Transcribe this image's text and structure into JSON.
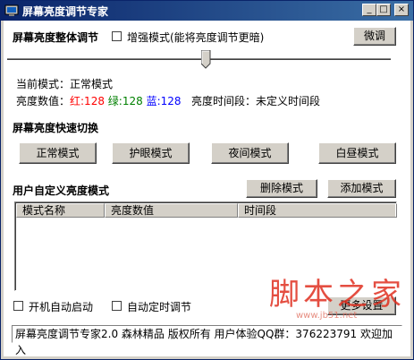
{
  "window": {
    "title": "屏幕亮度调节专家",
    "minimize": "_",
    "maximize": "□",
    "close": "×"
  },
  "overall": {
    "heading": "屏幕亮度整体调节",
    "enhance_label": "增强模式(能将亮度调节更暗)",
    "enhance_checked": false,
    "fine_tune_button": "微调",
    "slider_level_fraction": 0.52
  },
  "status": {
    "mode_label": "当前模式：",
    "mode_value": "正常模式",
    "brightness_label": "亮度数值：",
    "red_label": "红:128",
    "green_label": "绿:128",
    "blue_label": "蓝:128",
    "period_label": "亮度时间段：",
    "period_value": "未定义时间段",
    "colors": {
      "red": "#ff0000",
      "green": "#008000",
      "blue": "#0000ff"
    }
  },
  "quick": {
    "heading": "屏幕亮度快速切换",
    "buttons": [
      "正常模式",
      "护眼模式",
      "夜间模式",
      "白昼模式"
    ]
  },
  "custom": {
    "heading": "用户自定义亮度模式",
    "delete_button": "删除模式",
    "add_button": "添加模式",
    "columns": [
      "模式名称",
      "亮度数值",
      "时间段"
    ],
    "rows": []
  },
  "options": {
    "autostart_label": "开机自动启动",
    "autostart_checked": false,
    "timed_label": "自动定时调节",
    "timed_checked": false,
    "more_settings_button": "更多设置"
  },
  "statusbar": {
    "text": "屏幕亮度调节专家2.0 森林精品 版权所有 用户体验QQ群：376223791 欢迎加入"
  },
  "watermark": {
    "text": "脚本之家",
    "url": "www.jb51.net"
  }
}
